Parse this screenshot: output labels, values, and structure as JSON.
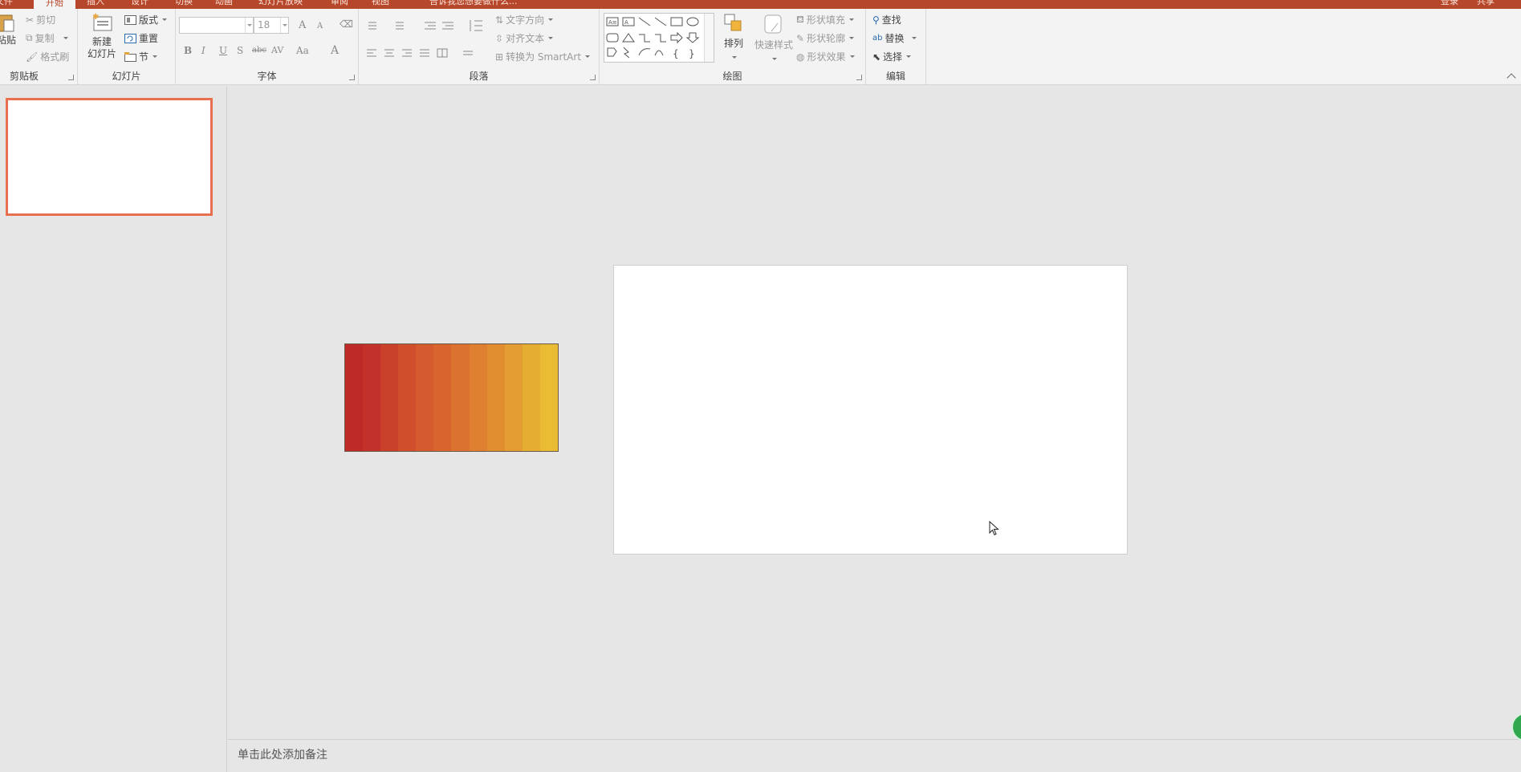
{
  "tabs": [
    {
      "label": "文件",
      "active": false
    },
    {
      "label": "开始",
      "active": true
    },
    {
      "label": "插入",
      "active": false
    },
    {
      "label": "设计",
      "active": false
    },
    {
      "label": "切换",
      "active": false
    },
    {
      "label": "动画",
      "active": false
    },
    {
      "label": "幻灯片放映",
      "active": false
    },
    {
      "label": "审阅",
      "active": false
    },
    {
      "label": "视图",
      "active": false
    }
  ],
  "search_hint": "告诉我您想要做什么...",
  "signin_label": "登录",
  "share_label": "共享",
  "ribbon": {
    "clipboard": {
      "label": "剪贴板",
      "paste": "粘贴",
      "cut": "剪切",
      "copy": "复制",
      "format_painter": "格式刷"
    },
    "slides": {
      "label": "幻灯片",
      "new_slide_line1": "新建",
      "new_slide_line2": "幻灯片",
      "layout": "版式",
      "reset": "重置",
      "section": "节"
    },
    "font": {
      "label": "字体",
      "font_name": "",
      "font_size": "18",
      "bold": "B",
      "italic": "I",
      "underline": "U",
      "shadow": "S",
      "strike": "abc",
      "spacing": "AV",
      "case": "Aa",
      "color": "A",
      "grow": "A",
      "shrink": "A"
    },
    "paragraph": {
      "label": "段落",
      "text_direction": "文字方向",
      "align_text": "对齐文本",
      "convert_smartart": "转换为 SmartArt"
    },
    "drawing": {
      "label": "绘图",
      "arrange": "排列",
      "quick_styles": "快速样式",
      "shape_fill": "形状填充",
      "shape_outline": "形状轮廓",
      "shape_effects": "形状效果"
    },
    "editing": {
      "label": "编辑",
      "find": "查找",
      "replace": "替换",
      "select": "选择"
    }
  },
  "gradient_colors": [
    "#bd2a27",
    "#c3322a",
    "#c9402b",
    "#d04e2c",
    "#d55a2d",
    "#d9652e",
    "#dc722f",
    "#df7f30",
    "#e18e31",
    "#e39d32",
    "#e6ad33",
    "#e9bc34"
  ],
  "notes_placeholder": "单击此处添加备注",
  "accent_color": "#b7472a"
}
